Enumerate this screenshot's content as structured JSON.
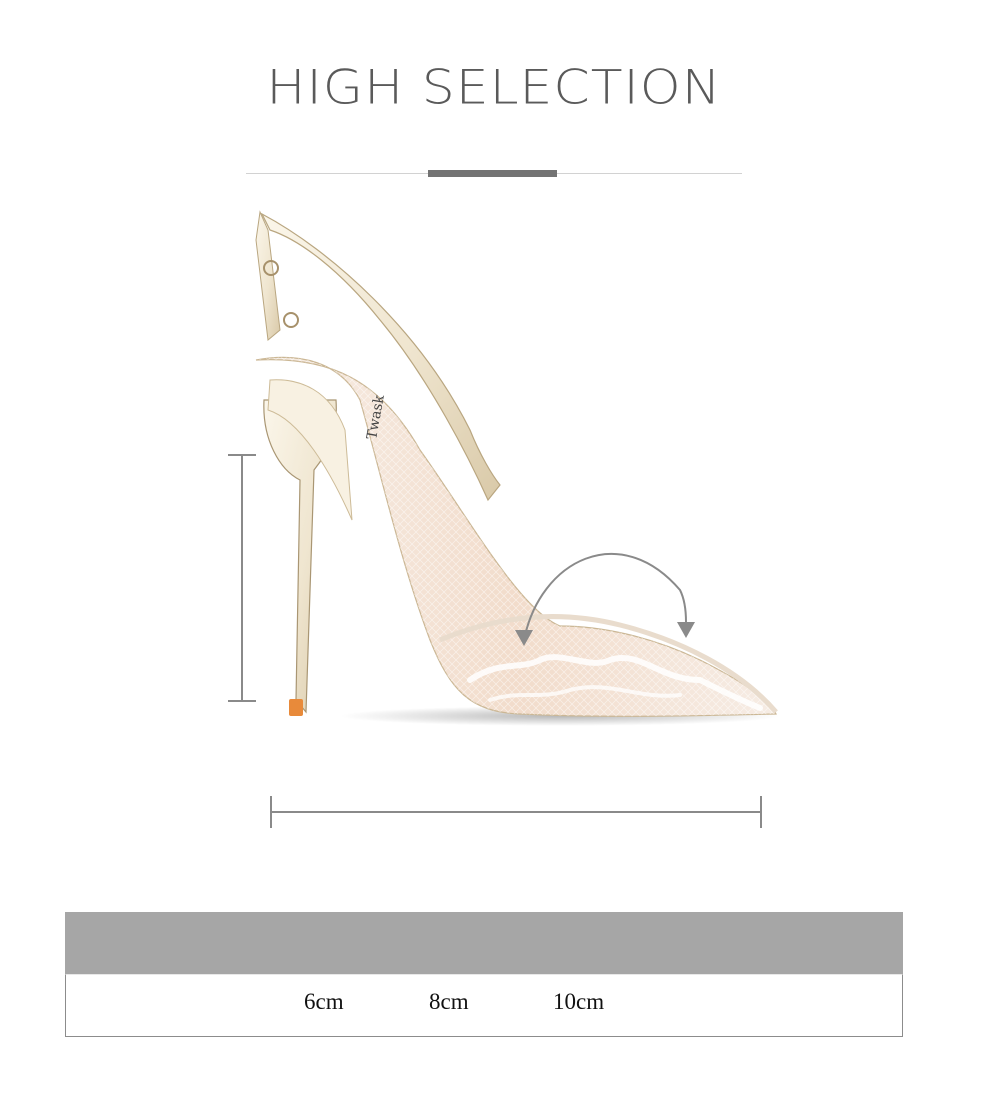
{
  "header": {
    "title": "HIGH SELECTION"
  },
  "product": {
    "image_label": "slingback-heel-image",
    "brand_mark": "Twask",
    "accent_colors": {
      "shoe_satin": "#efe5cf",
      "lace_skin": "#f2dccb",
      "heel_tip": "#e88a3a",
      "guide": "#8a8a8a"
    }
  },
  "size_table": {
    "header_color": "#a6a6a6",
    "sizes": [
      "6cm",
      "8cm",
      "10cm"
    ]
  }
}
